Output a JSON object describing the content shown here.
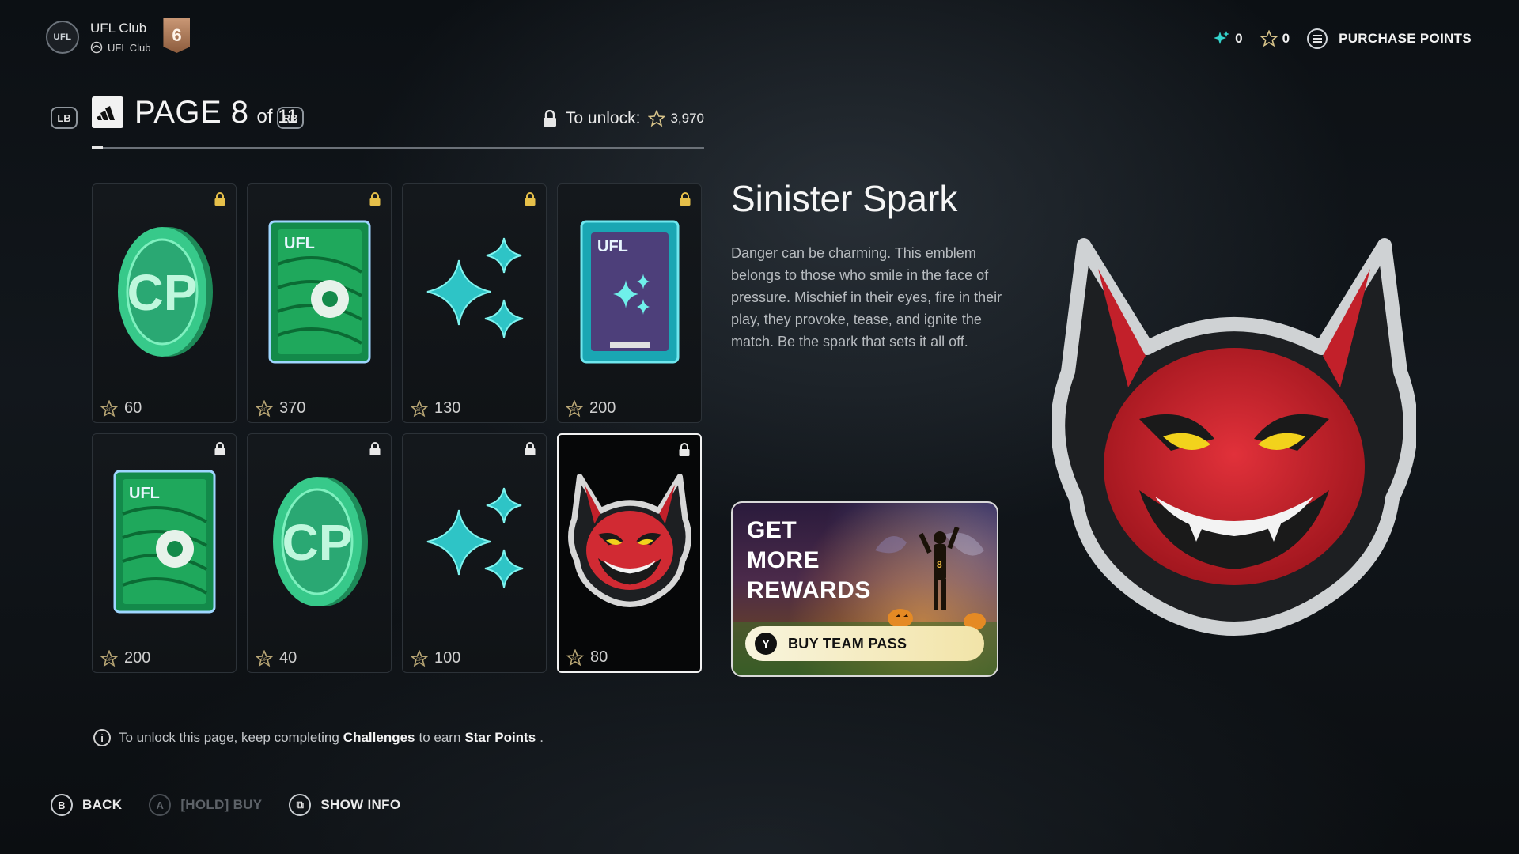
{
  "header": {
    "club_logo_text": "UFL",
    "club_name": "UFL Club",
    "club_sub": "UFL Club",
    "rank": "6",
    "currencies": [
      {
        "icon": "sparkle-icon",
        "value": "0"
      },
      {
        "icon": "star-points-icon",
        "value": "0"
      }
    ],
    "purchase_label": "PURCHASE POINTS"
  },
  "page": {
    "prev_button": "LB",
    "next_button": "RB",
    "title": "PAGE 8",
    "of_label": "of 11",
    "unlock_label": "To unlock:",
    "unlock_cost": "3,970"
  },
  "rewards": [
    {
      "type": "coin",
      "icon": "cp-coin-icon",
      "price": "60",
      "locked": true,
      "selected": false
    },
    {
      "type": "pack-green",
      "icon": "player-pack-icon",
      "price": "370",
      "locked": true,
      "selected": false
    },
    {
      "type": "sparkles",
      "icon": "sparkles-icon",
      "price": "130",
      "locked": true,
      "selected": false
    },
    {
      "type": "pack-blue",
      "icon": "sparkle-pack-icon",
      "price": "200",
      "locked": true,
      "selected": false
    },
    {
      "type": "pack-green-small",
      "icon": "player-pack-icon",
      "price": "200",
      "locked": true,
      "selected": false
    },
    {
      "type": "coin",
      "icon": "cp-coin-icon",
      "price": "40",
      "locked": true,
      "selected": false
    },
    {
      "type": "sparkles",
      "icon": "sparkles-icon",
      "price": "100",
      "locked": true,
      "selected": false
    },
    {
      "type": "emblem",
      "icon": "devil-emblem-icon",
      "price": "80",
      "locked": true,
      "selected": true
    }
  ],
  "detail": {
    "title": "Sinister Spark",
    "description": "Danger can be charming. This emblem belongs to those who smile in the face of pressure. Mischief in their eyes, fire in their play, they provoke, tease, and ignite the match. Be the spark that sets it all off."
  },
  "promo": {
    "title": "GET MORE REWARDS",
    "button_key": "Y",
    "button_label": "BUY TEAM PASS"
  },
  "info": {
    "text_before": "To unlock this page, keep completing",
    "challenges": "Challenges",
    "text_middle": "to earn",
    "star_points": "Star Points",
    "text_after": "."
  },
  "footer": [
    {
      "key": "B",
      "label": "BACK",
      "enabled": true
    },
    {
      "key": "A",
      "label": "[HOLD] BUY",
      "enabled": false
    },
    {
      "key": "⧉",
      "label": "SHOW INFO",
      "enabled": true
    }
  ],
  "colors": {
    "accent_teal": "#2fd1c8",
    "coin_green": "#2fbf7a",
    "devil_red": "#d3252e",
    "gold": "#c9a25a"
  }
}
